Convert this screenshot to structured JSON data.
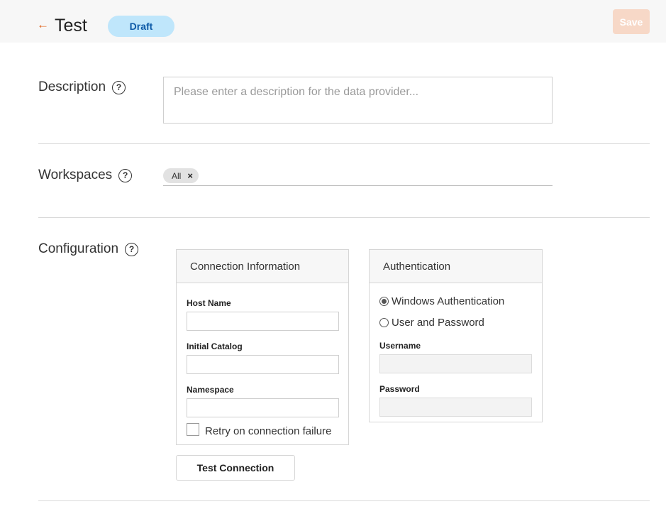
{
  "header": {
    "back_icon": "arrow-left-icon",
    "back_glyph": "←",
    "title": "Test",
    "status": "Draft",
    "save_label": "Save",
    "colors": {
      "accent": "#e0641e",
      "badge_bg": "#bfe6fb",
      "badge_text": "#0d5aa7",
      "save_bg": "#f7d8c7"
    }
  },
  "description": {
    "label": "Description",
    "help_glyph": "?",
    "value": "",
    "placeholder": "Please enter a description for the data provider..."
  },
  "workspaces": {
    "label": "Workspaces",
    "help_glyph": "?",
    "chips": [
      {
        "label": "All",
        "close_glyph": "×"
      }
    ]
  },
  "configuration": {
    "label": "Configuration",
    "help_glyph": "?",
    "connection": {
      "title": "Connection Information",
      "host_label": "Host Name",
      "host_value": "",
      "catalog_label": "Initial Catalog",
      "catalog_value": "",
      "namespace_label": "Namespace",
      "namespace_value": "",
      "retry_label": "Retry on connection failure",
      "retry_checked": false
    },
    "authentication": {
      "title": "Authentication",
      "options": [
        {
          "label": "Windows Authentication",
          "selected": true
        },
        {
          "label": "User and Password",
          "selected": false
        }
      ],
      "username_label": "Username",
      "username_value": "",
      "password_label": "Password",
      "password_value": ""
    },
    "test_button_label": "Test Connection"
  }
}
